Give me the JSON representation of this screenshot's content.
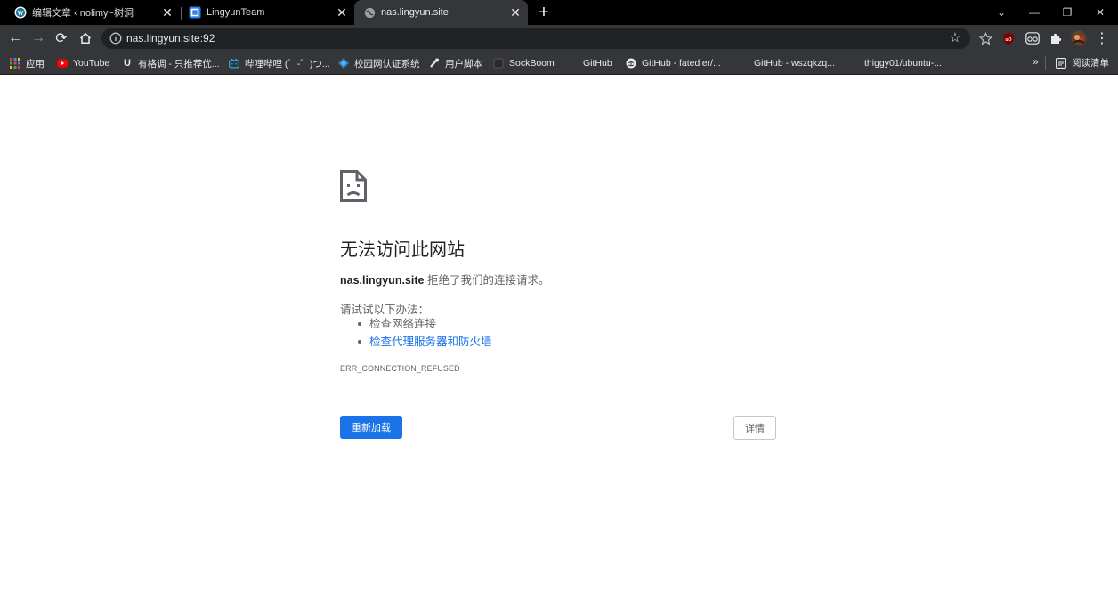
{
  "browser": {
    "tabs": [
      {
        "title": "编辑文章 ‹ nolimy~树洞",
        "icon": "wordpress-icon",
        "close": "✕"
      },
      {
        "title": "LingyunTeam",
        "icon": "lingyun-logo-icon",
        "close": "✕"
      },
      {
        "title": "nas.lingyun.site",
        "icon": "globe-icon",
        "close": "✕",
        "active": true
      }
    ],
    "new_tab": "+",
    "window_controls": {
      "dropdown": "⌄",
      "minimize": "—",
      "restore": "❐",
      "close": "✕"
    }
  },
  "toolbar": {
    "back": "←",
    "forward": "→",
    "reload": "⟳",
    "home": "home-icon",
    "url": "nas.lingyun.site:92",
    "star": "☆",
    "extensions": [
      "bookmark-star-icon",
      "ublock-icon",
      "reader-glasses-icon",
      "puzzle-icon",
      "profile-avatar-icon"
    ],
    "menu": "⋮"
  },
  "bookmarks": {
    "items": [
      {
        "label": "应用",
        "icon": "apps-grid-icon"
      },
      {
        "label": "YouTube",
        "icon": "youtube-icon"
      },
      {
        "label": "有格调 - 只推荐优...",
        "icon": "u-logo-icon"
      },
      {
        "label": "哔哩哔哩 (゜-゜)つ...",
        "icon": "bilibili-icon"
      },
      {
        "label": "校园网认证系统",
        "icon": "diamond-icon"
      },
      {
        "label": "用户脚本",
        "icon": "script-icon"
      },
      {
        "label": "SockBoom",
        "icon": "sockboom-icon"
      },
      {
        "label": "GitHub",
        "icon": "github-icon"
      },
      {
        "label": "GitHub - fatedier/...",
        "icon": "github-icon"
      },
      {
        "label": "GitHub - wszqkzq...",
        "icon": "github-icon"
      },
      {
        "label": "thiggy01/ubuntu-...",
        "icon": "github-icon"
      }
    ],
    "overflow": "»",
    "reading_list": "阅读清单"
  },
  "error_page": {
    "title": "无法访问此网站",
    "host": "nas.lingyun.site",
    "summary_suffix": " 拒绝了我们的连接请求。",
    "try_heading": "请试试以下办法：",
    "suggestions": [
      "检查网络连接",
      "检查代理服务器和防火墙"
    ],
    "error_code": "ERR_CONNECTION_REFUSED",
    "reload_button": "重新加载",
    "details_button": "详情"
  },
  "colors": {
    "accent": "#1a73e8",
    "toolbar_bg": "#35363a",
    "tabstrip_bg": "#000000"
  }
}
